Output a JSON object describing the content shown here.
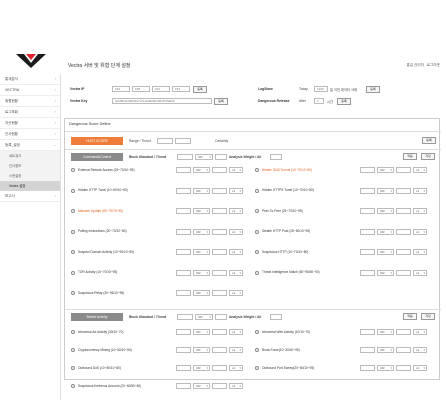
{
  "header": {
    "title": "Vectra 서버 및 위협 단계 설정",
    "admin": "홍길 관리자",
    "logout": "로그아웃"
  },
  "sidebar": {
    "items": [
      {
        "label": "통계분석"
      },
      {
        "label": "VECTRA"
      },
      {
        "label": "위협현황"
      },
      {
        "label": "로그조회"
      },
      {
        "label": "자산현황"
      },
      {
        "label": "인사현황"
      },
      {
        "label": "등록_설정"
      }
    ],
    "sub": [
      {
        "label": "네트워크"
      },
      {
        "label": "인사정보"
      },
      {
        "label": "스캔설정"
      },
      {
        "label": "Vectra 설정"
      }
    ],
    "tail": [
      {
        "label": "보고서"
      }
    ]
  },
  "server": {
    "ip_label": "Vectra IP",
    "ip_values": [
      "192",
      "168",
      "222",
      "153"
    ],
    "ip_btn": "등록",
    "key_label": "Vectra Key",
    "key_value": "0cb6812c390b2a7a7ec0dd69d1091f7dfa6b5",
    "key_btn": "등록",
    "logstore_label": "LogStore",
    "logstore_prefix": "Today",
    "logstore_days": "1200",
    "logstore_suffix": "일 이전 데이터 삭제",
    "logstore_btn": "등록",
    "release_label": "Dangerous Release",
    "release_prefix": "After",
    "release_days": "3",
    "release_suffix": "시간",
    "release_btn": "등록"
  },
  "define": {
    "title": "Dangerous Score Define",
    "host_score": "HOST SCORE",
    "range_label": "Range / Thrust",
    "certainty_label": "Certainty",
    "save_btn": "등록",
    "c2": {
      "label": "Command&Control",
      "block_label": "Block Standard / Threat",
      "or": "OR",
      "x1": "x1",
      "certainty": "Certainty",
      "weight_label": "Analysis Weight / All",
      "apply": "적용",
      "save": "저장",
      "left": [
        {
          "text": "External Remote Access (25~70/10~95)",
          "warn": false
        },
        {
          "text": "Hidden HTTP Tunel (10~60/10~80)",
          "warn": false
        },
        {
          "text": "Malware Update (65~75/75~95)",
          "warn": true
        },
        {
          "text": "Pulling Instructions (20~70/10~80)",
          "warn": false
        },
        {
          "text": "Suspect Domain Activity (10~90/10~80)",
          "warn": false
        },
        {
          "text": "TOR Activity (10~70/10~95)",
          "warn": false
        },
        {
          "text": "Suspicious Relay (30~95/10~95)",
          "warn": false
        }
      ],
      "right": [
        {
          "text": "Hidden DNS Tunnel (10~70/10~80)",
          "warn": true
        },
        {
          "text": "Hidden HTTPS Tunel (10~70/10~80)",
          "warn": false
        },
        {
          "text": "Peer-To-Peer (25~70/10~95)",
          "warn": false
        },
        {
          "text": "Stealth HTTP Post (25~50/10~95)",
          "warn": false
        },
        {
          "text": "Suspicious HTTP (10~70/10~80)",
          "warn": false
        },
        {
          "text": "Threat Intelligence Match (50~95/50~90)",
          "warn": false
        }
      ]
    },
    "botnet": {
      "label": "Botnet Activity",
      "block_label": "Block Standard / Threat",
      "weight_label": "Analysis Weight / All",
      "apply": "적용",
      "save": "저장",
      "left": [
        {
          "text": "Abnormal Ad Activity (30/10~70)",
          "warn": false
        },
        {
          "text": "Cryptocurrency Mining (10~50/10~50)",
          "warn": false
        },
        {
          "text": "Outbound DoS (10~80/10~80)",
          "warn": false
        },
        {
          "text": "Suspicious Kerberos Account (20~60/50~80)",
          "warn": false
        }
      ],
      "right": [
        {
          "text": "Abnormal Web Activity (10/10~70)",
          "warn": false
        },
        {
          "text": "Brute-Force(10~30/40~95)",
          "warn": false
        },
        {
          "text": "Outbound Port Sweep(20~50/10~95)",
          "warn": false
        }
      ]
    }
  },
  "colors": {
    "accent": "#f07c3a",
    "tab": "#8a8a8a"
  }
}
